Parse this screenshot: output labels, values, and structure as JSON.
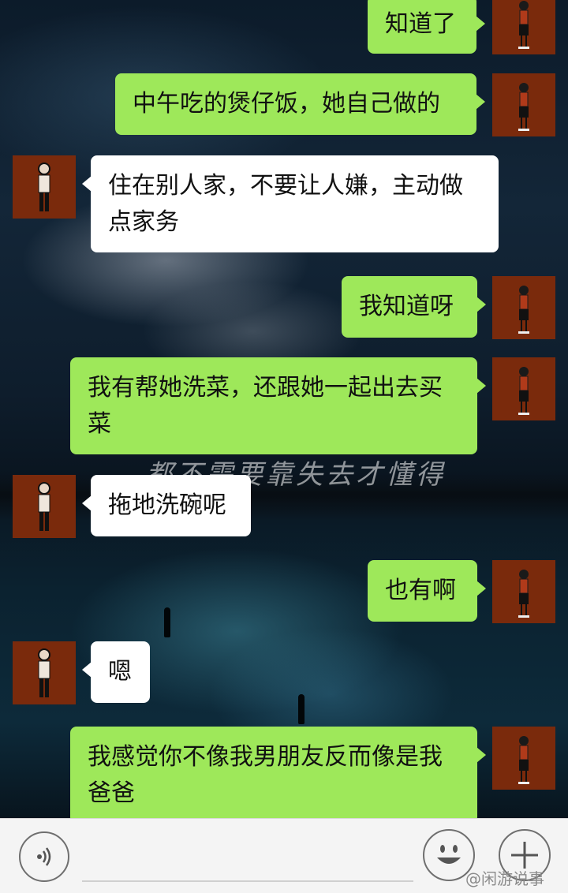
{
  "messages": [
    {
      "side": "me",
      "text": "知道了"
    },
    {
      "side": "me",
      "text": "中午吃的煲仔饭，她自己做的"
    },
    {
      "side": "them",
      "line1": "住在别人家，不要让人嫌，主动做",
      "line2": "点家务"
    },
    {
      "side": "me",
      "text": "我知道呀"
    },
    {
      "side": "me",
      "line1": "我有帮她洗菜，还跟她一起出去买",
      "line2": "菜"
    },
    {
      "side": "them",
      "text": "拖地洗碗呢"
    },
    {
      "side": "me",
      "text": "也有啊"
    },
    {
      "side": "them",
      "text": "嗯"
    },
    {
      "side": "me",
      "line1": "我感觉你不像我男朋友反而像是我",
      "line2": "爸爸"
    }
  ],
  "background": {
    "overlay_text": "都不需要靠失去才懂得"
  },
  "input_bar": {
    "text_value": "",
    "voice_icon": "voice-icon",
    "emoji_icon": "smiley-icon",
    "plus_icon": "plus-icon"
  },
  "watermark": "@闲游说事",
  "colors": {
    "my_bubble": "#9ee85a",
    "their_bubble": "#ffffff",
    "avatar_bg": "#7a2a0c"
  }
}
